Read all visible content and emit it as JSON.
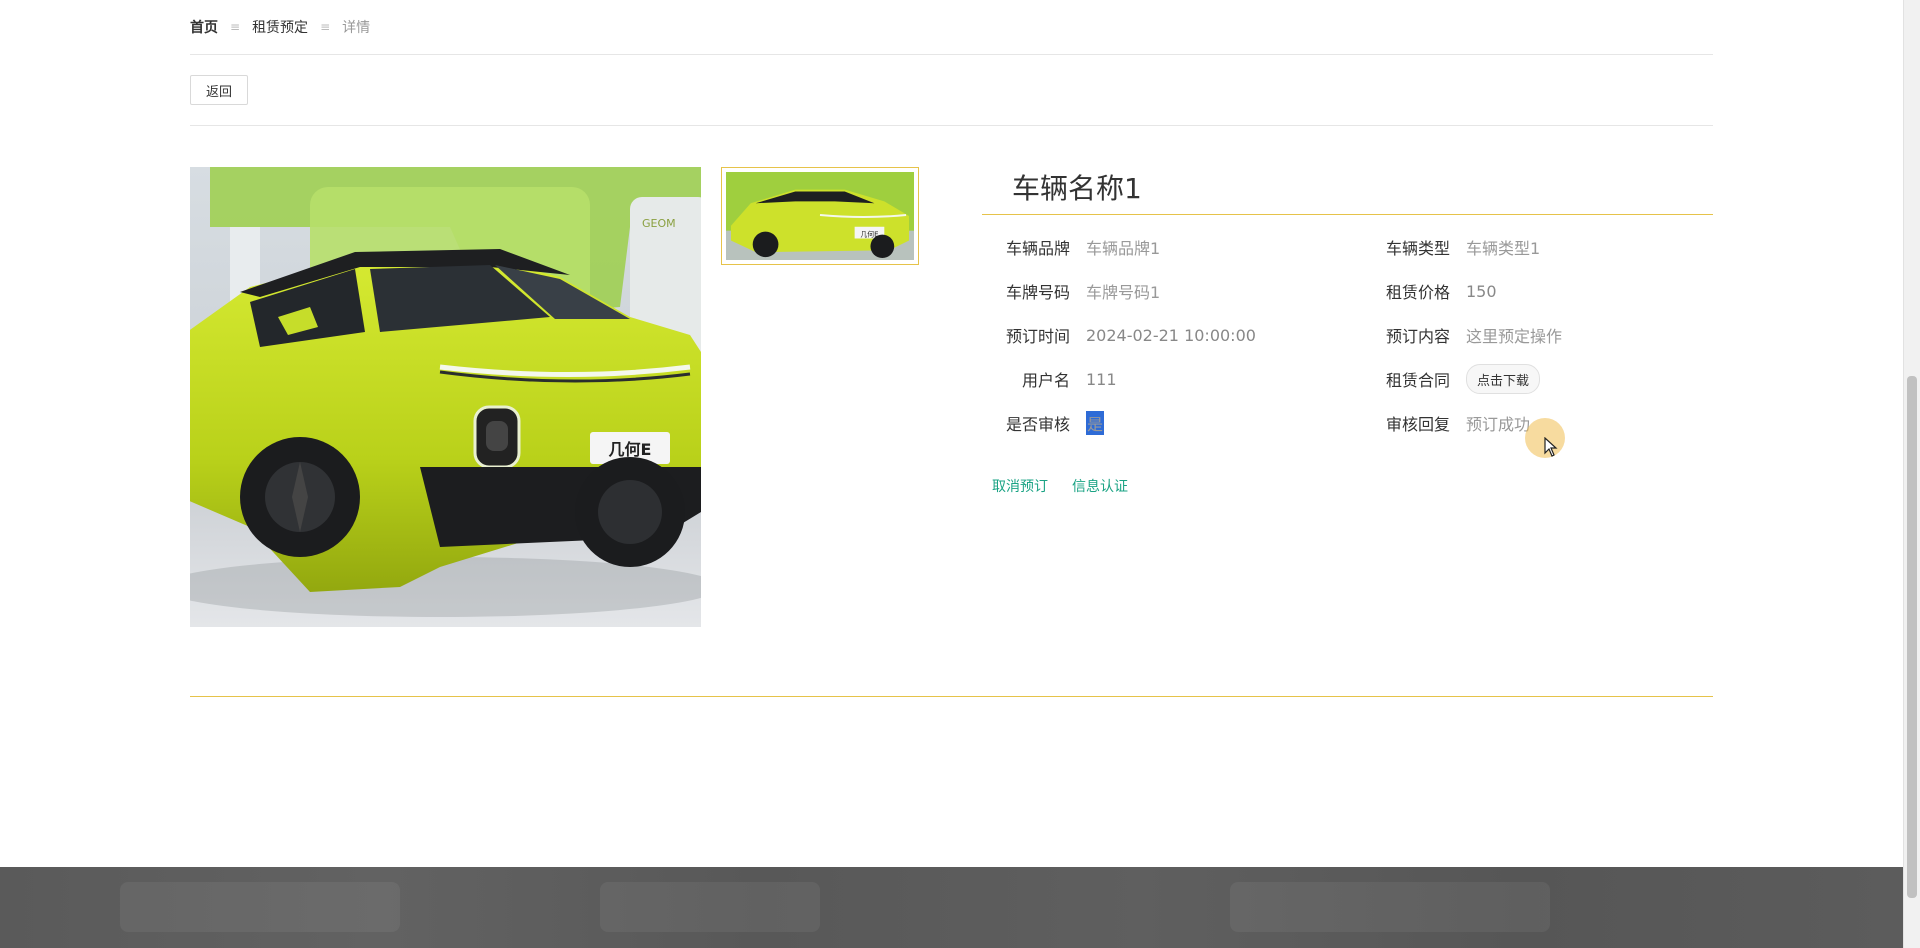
{
  "breadcrumb": {
    "home": "首页",
    "middle": "租赁预定",
    "current": "详情",
    "separator": "≡"
  },
  "toolbar": {
    "back_label": "返回"
  },
  "vehicle": {
    "title": "车辆名称1",
    "fields": {
      "brand_label": "车辆品牌",
      "brand_value": "车辆品牌1",
      "type_label": "车辆类型",
      "type_value": "车辆类型1",
      "plate_label": "车牌号码",
      "plate_value": "车牌号码1",
      "price_label": "租赁价格",
      "price_value": "150",
      "booking_time_label": "预订时间",
      "booking_time_value": "2024-02-21 10:00:00",
      "booking_content_label": "预订内容",
      "booking_content_value": "这里预定操作",
      "username_label": "用户名",
      "username_value": "111",
      "contract_label": "租赁合同",
      "contract_button": "点击下载",
      "reviewed_label": "是否审核",
      "reviewed_value": "是",
      "review_reply_label": "审核回复",
      "review_reply_value": "预订成功"
    },
    "plate_badge": "几何E",
    "thumb_badge": "几何E",
    "wall_brand": "GEOM"
  },
  "actions": {
    "cancel_booking": "取消预订",
    "info_auth": "信息认证"
  },
  "colors": {
    "accent_gold": "#e6c34a",
    "link_green": "#1aa384",
    "car_lime": "#c5dd1f",
    "footer_grey": "#5a5a5a"
  }
}
